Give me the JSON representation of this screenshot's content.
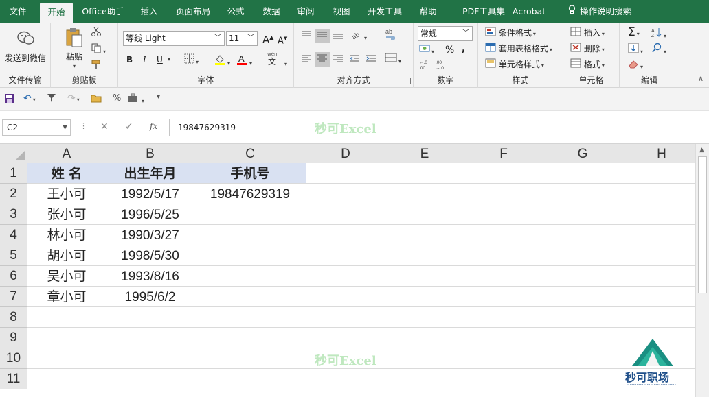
{
  "tabs": [
    "文件",
    "开始",
    "Office助手",
    "插入",
    "页面布局",
    "公式",
    "数据",
    "审阅",
    "视图",
    "开发工具",
    "帮助",
    "PDF工具集",
    "Acrobat"
  ],
  "tab_search": "操作说明搜索",
  "ribbon": {
    "wechat": {
      "label": "发送到微信",
      "group": "文件传输"
    },
    "clipboard": {
      "paste": "粘贴",
      "group": "剪贴板"
    },
    "font": {
      "name": "等线 Light",
      "size": "11",
      "bold": "B",
      "italic": "I",
      "underline": "U",
      "grow": "A",
      "shrink": "A",
      "group": "字体",
      "phonetic": "wén"
    },
    "alignment": {
      "group": "对齐方式"
    },
    "number": {
      "format": "常规",
      "percent": "%",
      "comma": ",",
      "group": "数字"
    },
    "styles": {
      "conditional": "条件格式",
      "table": "套用表格格式",
      "cell": "单元格样式",
      "group": "样式"
    },
    "cells": {
      "insert": "插入",
      "delete": "删除",
      "format": "格式",
      "group": "单元格"
    },
    "editing": {
      "group": "编辑"
    }
  },
  "qat": {
    "percent": "%"
  },
  "formula_bar": {
    "name_box": "C2",
    "value": "19847629319",
    "fx": "fx"
  },
  "watermark": "秒可Excel",
  "columns": [
    "A",
    "B",
    "C",
    "D",
    "E",
    "F",
    "G",
    "H"
  ],
  "rows": [
    "1",
    "2",
    "3",
    "4",
    "5",
    "6",
    "7",
    "8",
    "9",
    "10",
    "11"
  ],
  "table": {
    "headers": [
      "姓 名",
      "出生年月",
      "手机号"
    ],
    "data": [
      [
        "王小可",
        "1992/5/17",
        "19847629319"
      ],
      [
        "张小可",
        "1996/5/25",
        ""
      ],
      [
        "林小可",
        "1990/3/27",
        ""
      ],
      [
        "胡小可",
        "1998/5/30",
        ""
      ],
      [
        "吴小可",
        "1993/8/16",
        ""
      ],
      [
        "章小可",
        "1995/6/2",
        ""
      ]
    ]
  },
  "logo": {
    "name": "秒可职场"
  },
  "colors": {
    "accent": "#217346",
    "header_fill": "#d9e1f2"
  }
}
